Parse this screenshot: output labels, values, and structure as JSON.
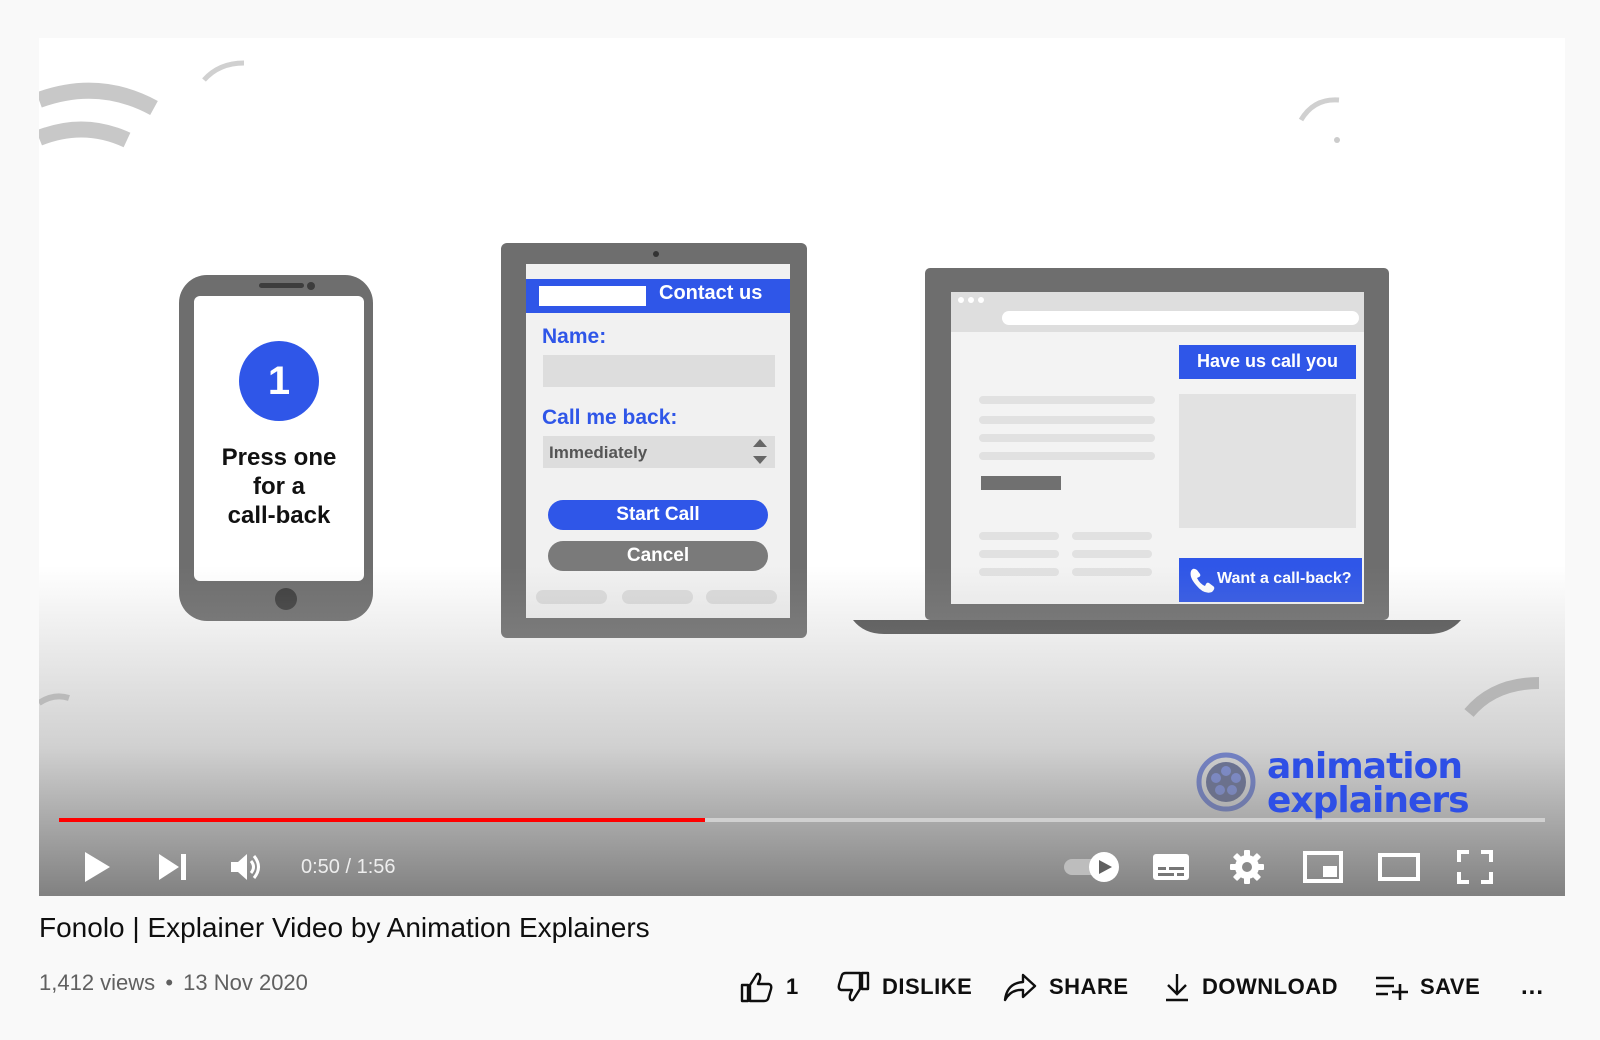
{
  "video": {
    "elapsed": "0:50",
    "duration": "1:56",
    "progress_fraction": 0.4348,
    "time_display": "0:50 / 1:56",
    "scene": {
      "phone_step_number": "1",
      "phone_line1": "Press one",
      "phone_line2": "for a",
      "phone_line3": "call-back",
      "tablet_header": "Contact us",
      "tablet_name_label": "Name:",
      "tablet_callback_label": "Call me back:",
      "tablet_select_value": "Immediately",
      "tablet_start_button": "Start Call",
      "tablet_cancel_button": "Cancel",
      "laptop_banner": "Have us call you",
      "laptop_callback_button": "Want a call-back?",
      "brand_line1": "animation",
      "brand_line2": "explainers"
    }
  },
  "controls": {
    "icons": [
      "play-icon",
      "next-icon",
      "volume-icon",
      "autoplay-toggle-icon",
      "subtitles-icon",
      "settings-icon",
      "miniplayer-icon",
      "theater-icon",
      "fullscreen-icon"
    ]
  },
  "info": {
    "title": "Fonolo | Explainer Video by Animation Explainers",
    "views": "1,412 views",
    "separator": "•",
    "date": "13 Nov 2020",
    "like_count": "1",
    "dislike_label": "DISLIKE",
    "share_label": "SHARE",
    "download_label": "DOWNLOAD",
    "save_label": "SAVE",
    "more_label": "..."
  },
  "colors": {
    "accent_blue": "#2f56e8",
    "progress_red": "#ff0000",
    "brand_blue": "#2e4fe6"
  }
}
